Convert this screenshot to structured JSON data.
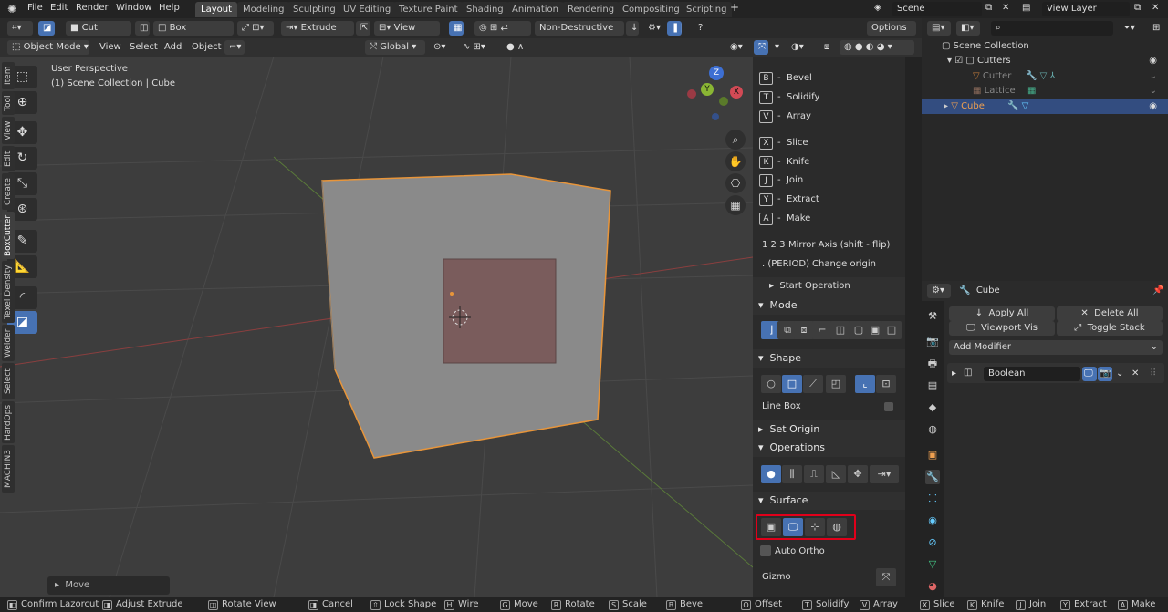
{
  "menu": {
    "file": "File",
    "edit": "Edit",
    "render": "Render",
    "window": "Window",
    "help": "Help"
  },
  "workspaces": [
    "Layout",
    "Modeling",
    "Sculpting",
    "UV Editing",
    "Texture Paint",
    "Shading",
    "Animation",
    "Rendering",
    "Compositing",
    "Scripting"
  ],
  "add_workspace": "+",
  "scene": {
    "scene_label": "Scene",
    "view_layer_label": "View Layer"
  },
  "tool_header": {
    "cut": "Cut",
    "box": "Box",
    "extrude": "Extrude",
    "view": "View",
    "non_destructive": "Non-Destructive",
    "options": "Options"
  },
  "view_header": {
    "mode": "Object Mode",
    "view": "View",
    "select": "Select",
    "add": "Add",
    "object": "Object",
    "orientation": "Global"
  },
  "viewport": {
    "perspective": "User Perspective",
    "collection": "(1) Scene Collection | Cube",
    "operator_panel": "Move"
  },
  "gizmo_axes": {
    "z": "Z",
    "y": "Y",
    "x": "X"
  },
  "shortcuts": [
    {
      "key": "B",
      "label": "Bevel"
    },
    {
      "key": "T",
      "label": "Solidify"
    },
    {
      "key": "V",
      "label": "Array"
    },
    {
      "key": "X",
      "label": "Slice"
    },
    {
      "key": "K",
      "label": "Knife"
    },
    {
      "key": "J",
      "label": "Join"
    },
    {
      "key": "Y",
      "label": "Extract"
    },
    {
      "key": "A",
      "label": "Make"
    }
  ],
  "mirror_axis": {
    "keys": "1 2 3",
    "label": "Mirror Axis (shift - flip)"
  },
  "change_origin": {
    "key": ". (PERIOD)",
    "label": "Change origin"
  },
  "start_operation": "Start Operation",
  "sections": {
    "mode": "Mode",
    "shape": "Shape",
    "set_origin": "Set Origin",
    "operations": "Operations",
    "surface": "Surface"
  },
  "line_box": "Line Box",
  "auto_ortho": "Auto Ortho",
  "gizmo": "Gizmo",
  "side_tabs": [
    "Item",
    "Tool",
    "View",
    "Edit",
    "Create",
    "BoxCutter",
    "Texel Density",
    "Welder",
    "Select",
    "HardOps",
    "MACHIN3"
  ],
  "active_side_tab": "BoxCutter",
  "outliner": {
    "scene_collection": "Scene Collection",
    "cutters": "Cutters",
    "cutter": "Cutter",
    "lattice": "Lattice",
    "cube": "Cube"
  },
  "properties": {
    "object": "Cube",
    "apply_all": "Apply All",
    "delete_all": "Delete All",
    "viewport_vis": "Viewport Vis",
    "toggle_stack": "Toggle Stack",
    "add_modifier": "Add Modifier",
    "modifier_name": "Boolean"
  },
  "status": [
    {
      "key": "",
      "label": "Confirm Lazorcut"
    },
    {
      "key": "",
      "label": "Adjust Extrude"
    },
    {
      "key": "",
      "label": "Rotate View"
    },
    {
      "key": "",
      "label": "Cancel"
    },
    {
      "key": "",
      "label": "Lock Shape"
    },
    {
      "key": "H",
      "label": "Wire"
    },
    {
      "key": "G",
      "label": "Move"
    },
    {
      "key": "R",
      "label": "Rotate"
    },
    {
      "key": "S",
      "label": "Scale"
    },
    {
      "key": "B",
      "label": "Bevel"
    },
    {
      "key": "O",
      "label": "Offset"
    },
    {
      "key": "T",
      "label": "Solidify"
    },
    {
      "key": "V",
      "label": "Array"
    },
    {
      "key": "X",
      "label": "Slice"
    },
    {
      "key": "K",
      "label": "Knife"
    },
    {
      "key": "J",
      "label": "Join"
    },
    {
      "key": "Y",
      "label": "Extract"
    },
    {
      "key": "A",
      "label": "Make"
    }
  ],
  "colors": {
    "accent": "#4772b3",
    "selection_outline": "#e8953a",
    "highlight_box": "#e0001a",
    "cutter_fill": "#7a5c5c"
  }
}
